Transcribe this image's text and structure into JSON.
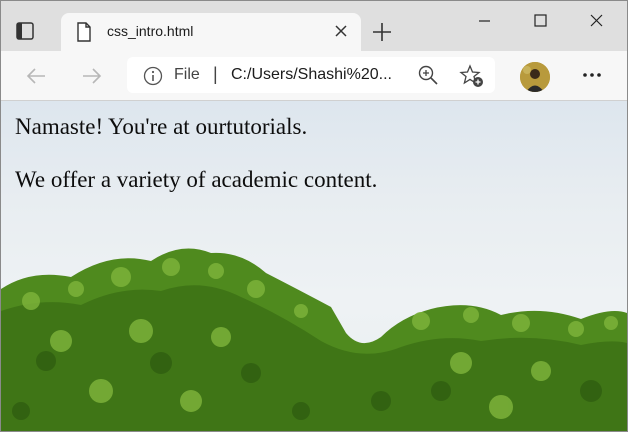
{
  "browser": {
    "tab": {
      "title": "css_intro.html",
      "favicon": "document-icon"
    },
    "address": {
      "scheme": "File",
      "separator": "|",
      "url": "C:/Users/Shashi%20..."
    },
    "window_controls": [
      "minimize",
      "maximize",
      "close"
    ]
  },
  "page": {
    "paragraphs": [
      "Namaste! You're at ourtutorials.",
      "We offer a variety of academic content."
    ],
    "background": "sky and green foliage photo"
  },
  "colors": {
    "tabbar": "#dfdfdf",
    "toolbar": "#f7f7f7",
    "foliage": "#4f8a1e"
  }
}
